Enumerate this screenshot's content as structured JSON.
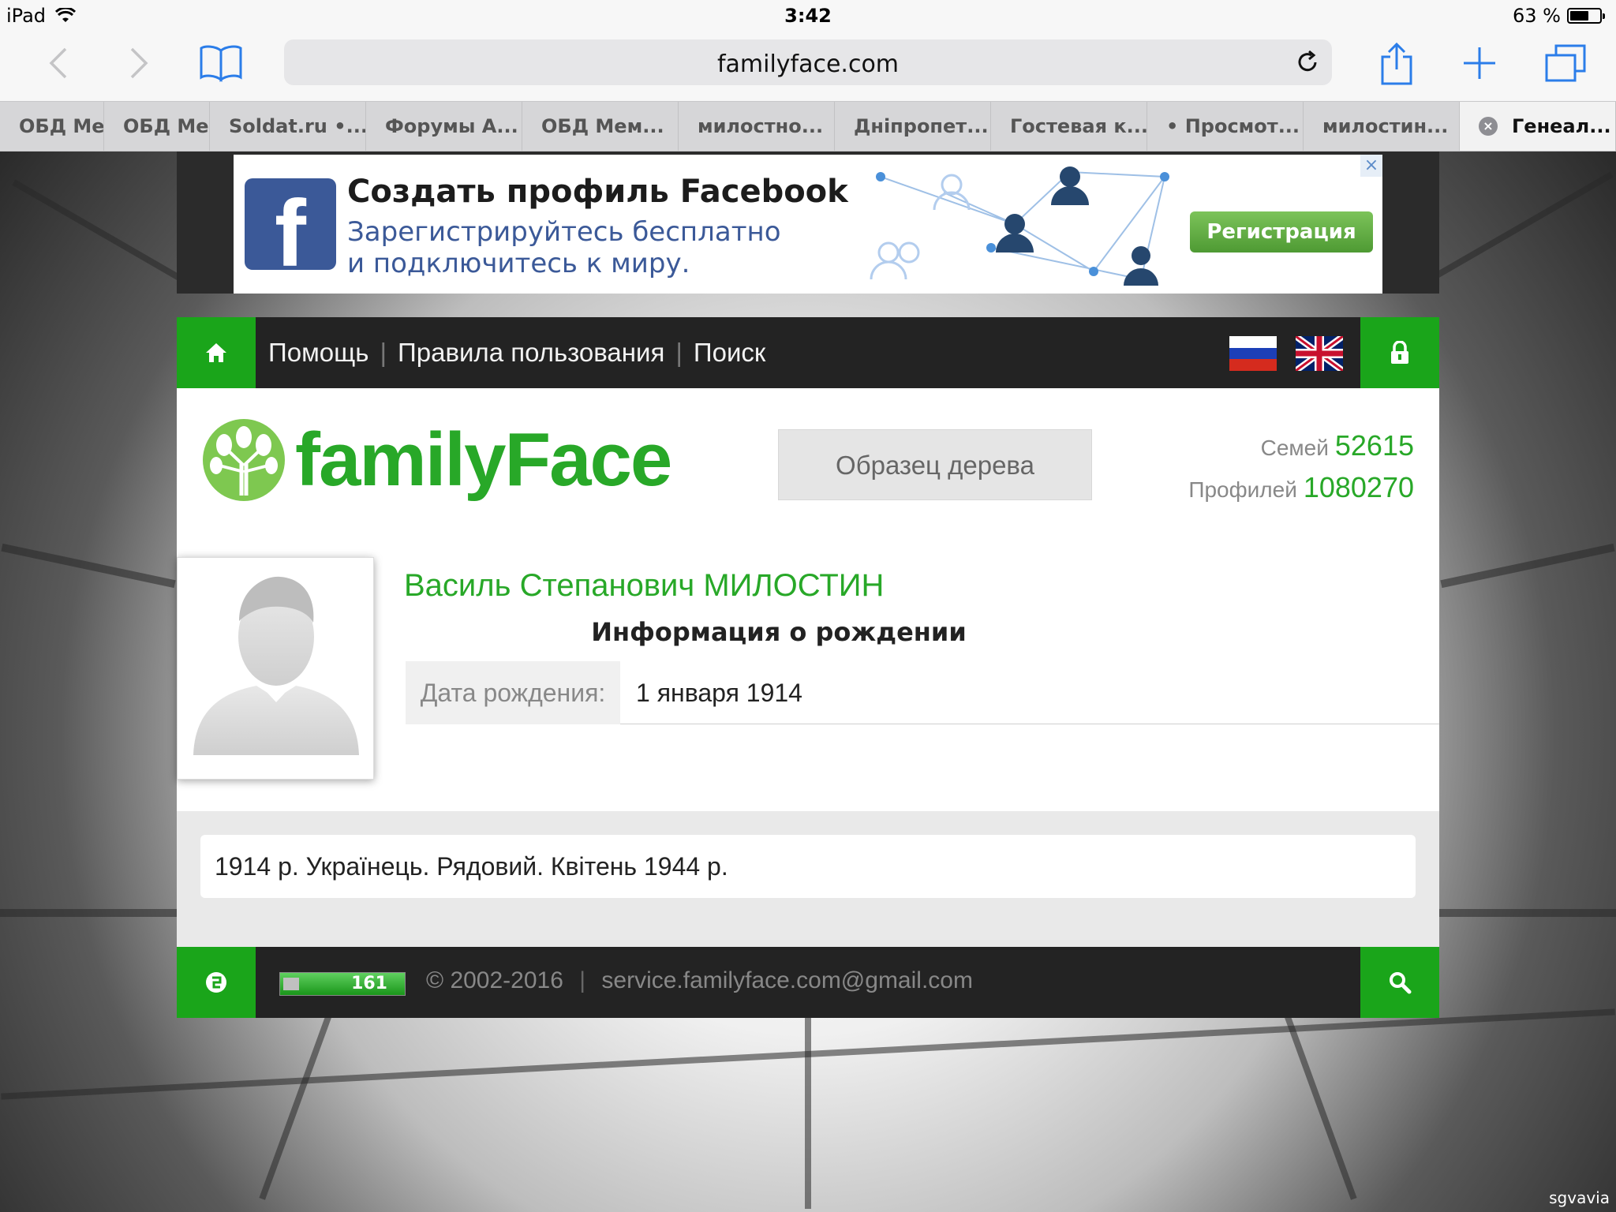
{
  "statusbar": {
    "device": "iPad",
    "time": "3:42",
    "battery": "63 %",
    "battery_level": 0.63
  },
  "browser": {
    "url": "familyface.com",
    "icons": [
      "back-icon",
      "forward-icon",
      "bookmarks-icon",
      "reload-icon",
      "share-icon",
      "new-tab-icon",
      "tabs-icon"
    ]
  },
  "tabs": [
    {
      "label": "ОБД Мем"
    },
    {
      "label": "ОБД Мем"
    },
    {
      "label": "Soldat.ru •..."
    },
    {
      "label": "Форумы А..."
    },
    {
      "label": "ОБД Мем..."
    },
    {
      "label": "милостно..."
    },
    {
      "label": "Дніпропет..."
    },
    {
      "label": "Гостевая к..."
    },
    {
      "label": "• Просмот..."
    },
    {
      "label": "милостин..."
    },
    {
      "label": "Генеал...",
      "active": true
    }
  ],
  "ad": {
    "line1": "Создать профиль Facebook",
    "line2": "Зарегистрируйтесь бесплатно",
    "line3": "и подключитесь к миру.",
    "button": "Регистрация",
    "brand_color": "#3b5998"
  },
  "nav": {
    "help": "Помощь",
    "rules": "Правила пользования",
    "search": "Поиск",
    "accent": "#1aa51a"
  },
  "site": {
    "logo": "familyFace",
    "sample_tree": "Образец дерева",
    "families_label": "Семей",
    "families_count": "52615",
    "profiles_label": "Профилей",
    "profiles_count": "1080270"
  },
  "profile": {
    "name": "Василь Степанович МИЛОСТИН",
    "section": "Информация о рождении",
    "birth_label": "Дата рождения:",
    "birth_value": "1 января 1914",
    "note": "1914 р. Українець. Рядовий. Квітень 1944 р."
  },
  "footer": {
    "counter": "161",
    "copyright": "© 2002-2016",
    "email": "service.familyface.com@gmail.com"
  },
  "watermark": "sgvavia"
}
